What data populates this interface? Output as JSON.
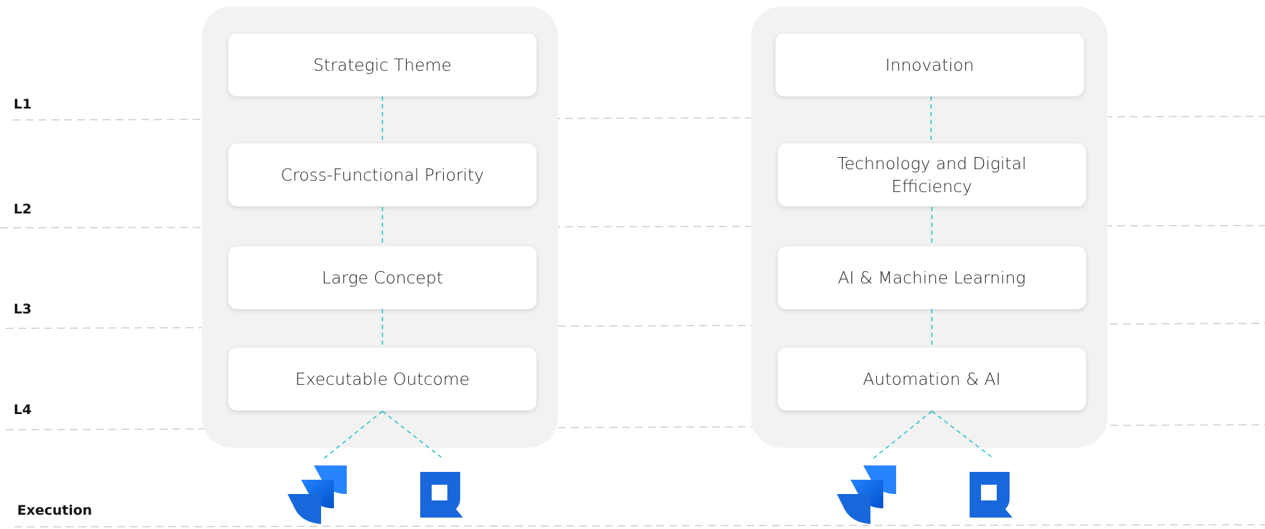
{
  "levels": [
    "L1",
    "L2",
    "L3",
    "L4",
    "Execution"
  ],
  "columns": [
    {
      "cards": [
        "Strategic Theme",
        "Cross-Functional Priority",
        "Large Concept",
        "Executable Outcome"
      ],
      "tools": [
        "jira-icon",
        "jira-service-management-icon"
      ]
    },
    {
      "cards": [
        "Innovation",
        "Technology and Digital Efficiency",
        "AI & Machine Learning",
        "Automation & AI"
      ],
      "tools": [
        "jira-icon",
        "jira-service-management-icon"
      ]
    }
  ],
  "colors": {
    "panel": "#f2f2f2",
    "connector": "#2ec4c9",
    "divider": "#d0d0d0",
    "jira": "#1868DB"
  }
}
